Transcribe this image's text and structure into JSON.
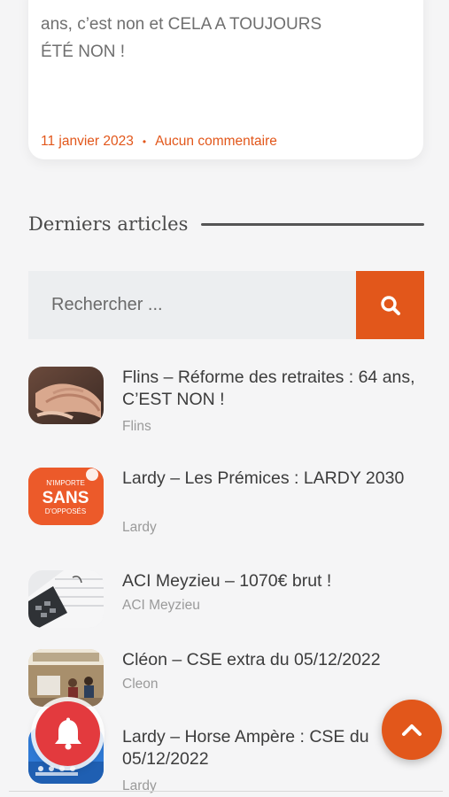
{
  "top_card": {
    "excerpt": "ans, c’est non et CELA A TOUJOURS\nÉTÉ NON !",
    "date": "11 janvier 2023",
    "separator": "•",
    "comments": "Aucun commentaire"
  },
  "sidebar": {
    "section_title": "Derniers articles",
    "search": {
      "placeholder": "Rechercher ...",
      "button_icon": "search-icon"
    },
    "articles": [
      {
        "title": "Flins – Réforme des retraites : 64 ans, C’EST NON !",
        "category": "Flins",
        "thumb_icon": "hands-photo"
      },
      {
        "title": "Lardy – Les Prémices : LARDY 2030",
        "category": "Lardy",
        "thumb_icon": "logo-sans-opposes"
      },
      {
        "title": "ACI Meyzieu – 1070€ brut !",
        "category": "ACI Meyzieu",
        "thumb_icon": "calculator-photo"
      },
      {
        "title": "Cléon – CSE extra du 05/12/2022",
        "category": "Cleon",
        "thumb_icon": "meeting-room-photo"
      },
      {
        "title": "Lardy – Horse Ampère : CSE du 05/12/2022",
        "category": "Lardy",
        "thumb_icon": "horse-ampere-photo"
      }
    ],
    "thumb_logo_text": {
      "line1": "N'IMPORTE",
      "line2": "SANS",
      "line3": "D'OPPOSÉS"
    }
  },
  "floating": {
    "bell_icon": "bell-icon",
    "back_to_top_icon": "chevron-up-icon"
  },
  "colors": {
    "accent": "#e2571b",
    "bell": "#e33a3e",
    "background": "#f5f5f6"
  }
}
